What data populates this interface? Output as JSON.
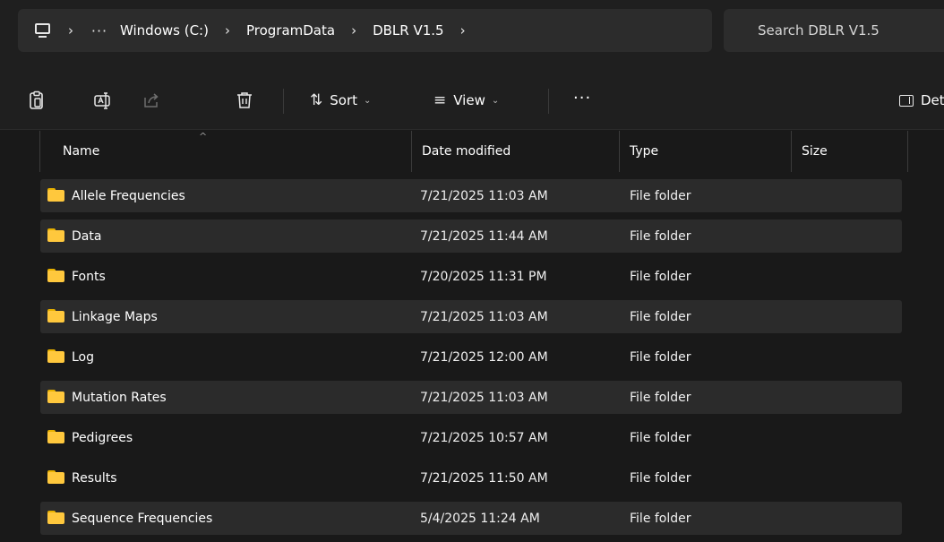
{
  "address": {
    "crumbs": [
      "Windows (C:)",
      "ProgramData",
      "DBLR V1.5"
    ],
    "more": "···",
    "separator": "›"
  },
  "search": {
    "placeholder": "Search DBLR V1.5"
  },
  "commandbar": {
    "sort_label": "Sort",
    "view_label": "View",
    "more_label": "···",
    "details_label": "Details"
  },
  "columns": {
    "name": "Name",
    "date": "Date modified",
    "type": "Type",
    "size": "Size"
  },
  "files": [
    {
      "name": "Allele Frequencies",
      "date": "7/21/2025 11:03 AM",
      "type": "File folder",
      "size": ""
    },
    {
      "name": "Data",
      "date": "7/21/2025 11:44 AM",
      "type": "File folder",
      "size": ""
    },
    {
      "name": "Fonts",
      "date": "7/20/2025 11:31 PM",
      "type": "File folder",
      "size": ""
    },
    {
      "name": "Linkage Maps",
      "date": "7/21/2025 11:03 AM",
      "type": "File folder",
      "size": ""
    },
    {
      "name": "Log",
      "date": "7/21/2025 12:00 AM",
      "type": "File folder",
      "size": ""
    },
    {
      "name": "Mutation Rates",
      "date": "7/21/2025 11:03 AM",
      "type": "File folder",
      "size": ""
    },
    {
      "name": "Pedigrees",
      "date": "7/21/2025 10:57 AM",
      "type": "File folder",
      "size": ""
    },
    {
      "name": "Results",
      "date": "7/21/2025 11:50 AM",
      "type": "File folder",
      "size": ""
    },
    {
      "name": "Sequence Frequencies",
      "date": "5/4/2025 11:24 AM",
      "type": "File folder",
      "size": ""
    }
  ],
  "colors": {
    "background": "#191919",
    "toolbar": "#1f1f1f",
    "row_highlight": "#2b2b2b",
    "folder": "#ffc83d"
  },
  "icons": [
    "computer-icon",
    "paste-icon",
    "rename-icon",
    "share-icon",
    "delete-icon",
    "sort-icon",
    "view-icon",
    "details-pane-icon",
    "folder-icon"
  ]
}
